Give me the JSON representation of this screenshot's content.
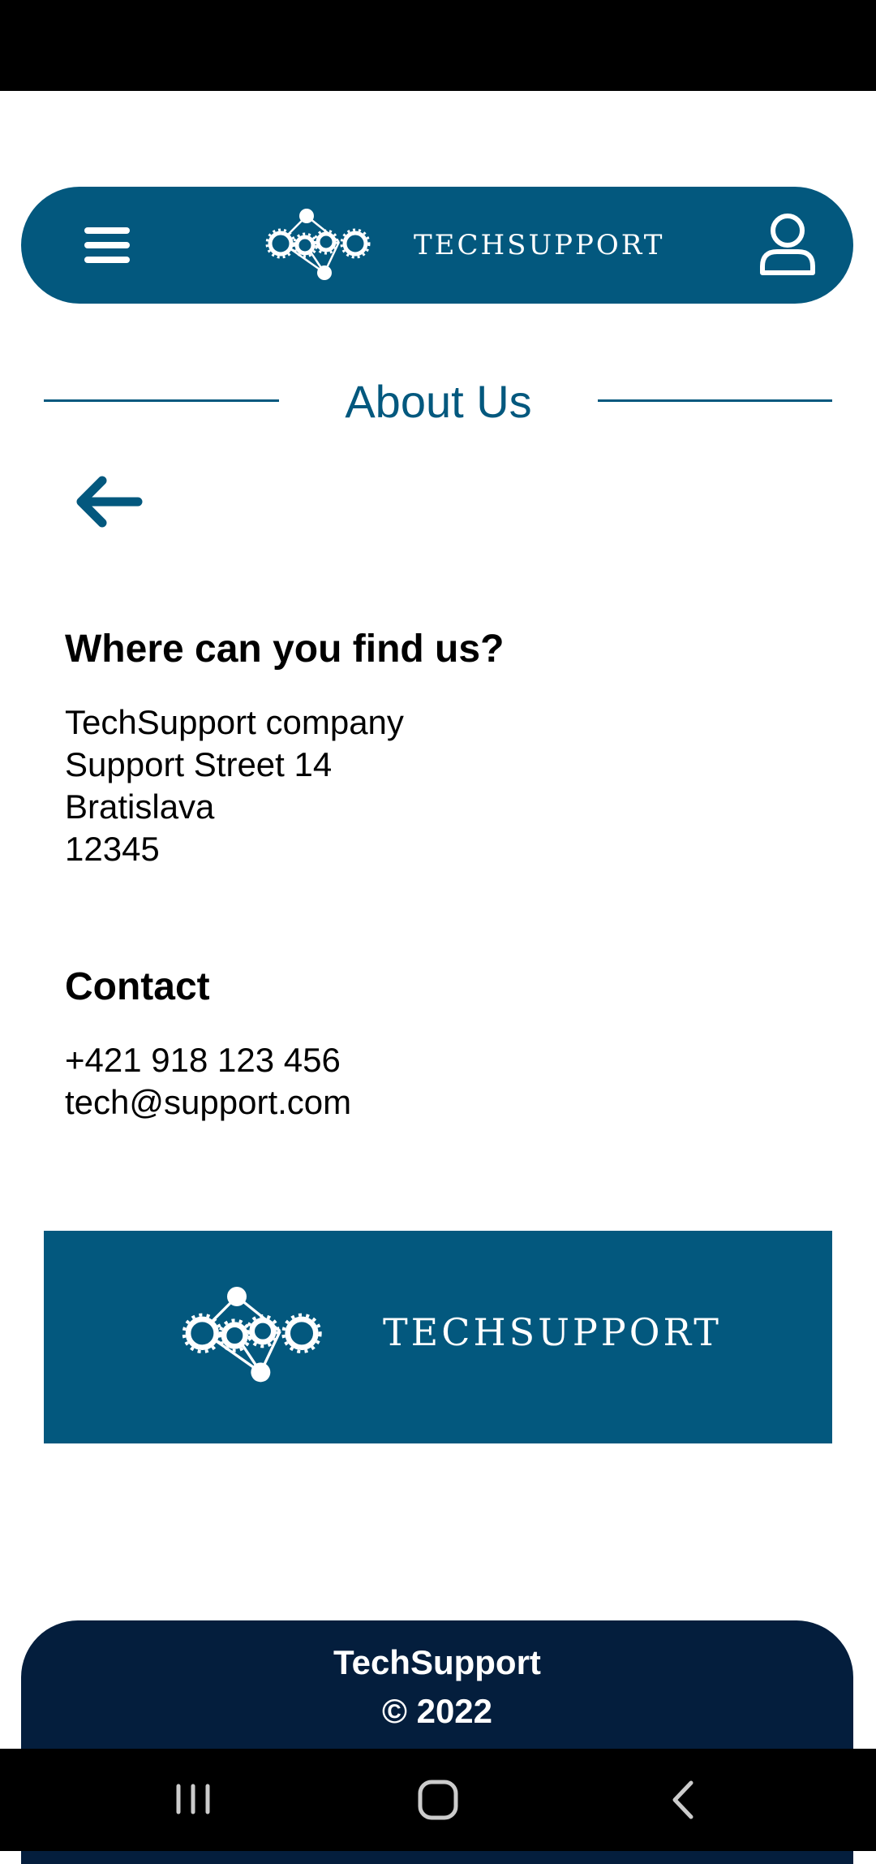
{
  "header": {
    "brand": "TECHSUPPORT"
  },
  "page": {
    "title": "About Us"
  },
  "address": {
    "heading": "Where can you find us?",
    "lines": "TechSupport company\nSupport Street 14\nBratislava\n12345"
  },
  "contact": {
    "heading": "Contact",
    "lines": "+421 918 123 456\ntech@support.com"
  },
  "banner": {
    "brand": "TECHSUPPORT"
  },
  "footer": {
    "company": "TechSupport",
    "copyright": "© 2022"
  },
  "icons": {
    "menu": "hamburger-menu-icon",
    "user": "user-icon",
    "back": "arrow-left-icon",
    "logo": "gears-network-logo-icon",
    "nav_recent": "recent-apps-icon",
    "nav_home": "home-icon",
    "nav_back": "chevron-left-icon"
  },
  "colors": {
    "primary": "#03587e",
    "footer": "#041e3d",
    "text": "#000000",
    "background": "#ffffff"
  }
}
